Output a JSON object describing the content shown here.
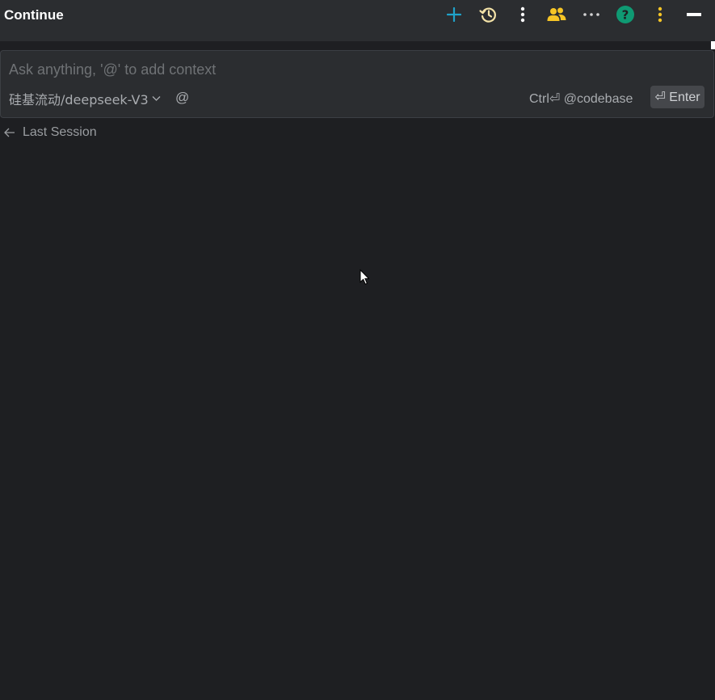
{
  "header": {
    "title": "Continue",
    "icons": [
      "plus-icon",
      "history-icon",
      "more-vertical-icon",
      "people-icon",
      "more-horizontal-icon",
      "help-icon",
      "more-vertical-icon",
      "minimize-icon"
    ],
    "colors": {
      "plus": "#1fa2c9",
      "history": "#f4e3a8",
      "people": "#f6c526",
      "help": "#0f9a73",
      "kebab_yellow": "#f6c526"
    }
  },
  "input": {
    "placeholder": "Ask anything, '@' to add context",
    "value": "",
    "model": "硅基流动/deepseek-V3",
    "at_symbol": "@",
    "ctrl_hint": "Ctrl⏎ @codebase",
    "enter_label": "⏎ Enter"
  },
  "session": {
    "last_session_label": "Last Session"
  }
}
